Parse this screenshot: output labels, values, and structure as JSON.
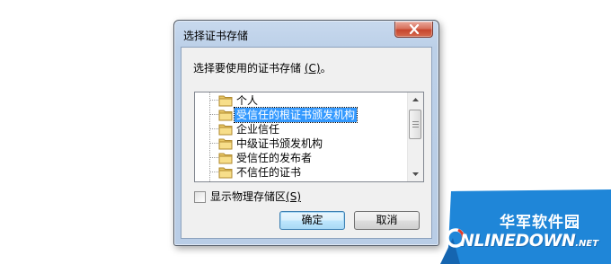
{
  "dialog": {
    "title": "选择证书存储",
    "prompt": "选择要使用的证书存储 ",
    "prompt_accel": "(C)",
    "prompt_end": "。",
    "close_icon": "close-icon",
    "stores": [
      {
        "label": "个人",
        "selected": false
      },
      {
        "label": "受信任的根证书颁发机构",
        "selected": true
      },
      {
        "label": "企业信任",
        "selected": false
      },
      {
        "label": "中级证书颁发机构",
        "selected": false
      },
      {
        "label": "受信任的发布者",
        "selected": false
      },
      {
        "label": "不信任的证书",
        "selected": false
      }
    ],
    "show_physical_label": "显示物理存储区",
    "show_physical_accel": "(S)",
    "show_physical_checked": false,
    "ok_label": "确定",
    "cancel_label": "取消"
  },
  "watermark": {
    "cn_text": "华军软件园",
    "en_text": "NLINEDOWN",
    "en_suffix": ".NET",
    "colors": {
      "blue": "#1f86d8",
      "red": "#e23a2a"
    }
  },
  "colors": {
    "selection": "#3399ff",
    "window_frame": "#bcd0e8",
    "close_button": "#c7452d"
  }
}
